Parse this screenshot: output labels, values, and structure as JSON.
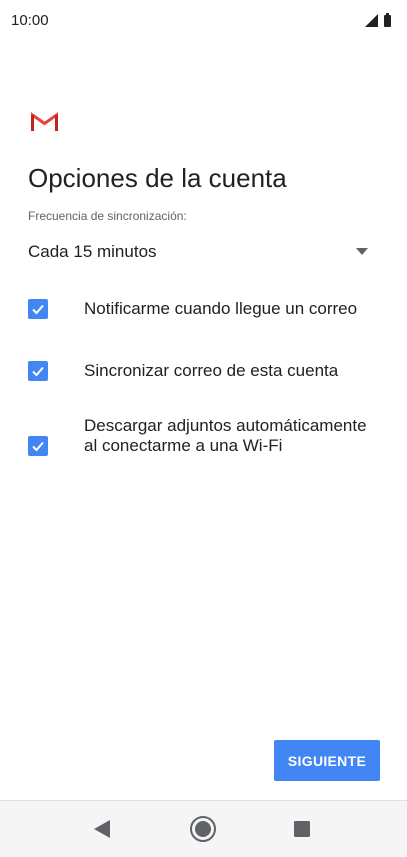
{
  "status_bar": {
    "time": "10:00",
    "icons": [
      "signal-icon",
      "battery-icon"
    ]
  },
  "app": {
    "logo": "gmail-logo"
  },
  "page": {
    "title": "Opciones de la cuenta",
    "sync_label": "Frecuencia de sincronización:",
    "sync_value": "Cada 15 minutos"
  },
  "options": [
    {
      "label": "Notificarme cuando llegue un correo",
      "checked": true
    },
    {
      "label": "Sincronizar correo de esta cuenta",
      "checked": true
    },
    {
      "label": "Descargar adjuntos automáticamente al conectarme a una Wi-Fi",
      "checked": true
    }
  ],
  "actions": {
    "next_label": "SIGUIENTE"
  },
  "nav_bar": {
    "icons": [
      "back-icon",
      "home-icon",
      "recents-icon"
    ]
  },
  "colors": {
    "accent": "#4285f4",
    "gmail_red": "#ea4335",
    "text_primary": "#202124",
    "text_secondary": "#5f6368"
  }
}
